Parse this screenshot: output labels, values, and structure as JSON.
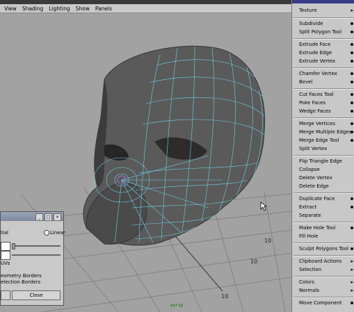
{
  "viewport_menu": [
    "View",
    "Shading",
    "Lighting",
    "Show",
    "Panels"
  ],
  "camera_label": "persp",
  "grid_labels": [
    "10",
    "10",
    "10"
  ],
  "marking_menu": {
    "items": [
      {
        "label": "Texture",
        "kind": "submenu"
      },
      {
        "label": "Subdivide",
        "kind": "option"
      },
      {
        "label": "Split Polygon Tool",
        "kind": "option"
      },
      {
        "label": "Extrude Face",
        "kind": "option"
      },
      {
        "label": "Extrude Edge",
        "kind": "option"
      },
      {
        "label": "Extrude Vertex",
        "kind": "option"
      },
      {
        "label": "Chamfer Vertex",
        "kind": "option"
      },
      {
        "label": "Bevel",
        "kind": "option"
      },
      {
        "label": "Cut Faces Tool",
        "kind": "option"
      },
      {
        "label": "Poke Faces",
        "kind": "option"
      },
      {
        "label": "Wedge Faces",
        "kind": "option"
      },
      {
        "label": "Merge Vertices",
        "kind": "option"
      },
      {
        "label": "Merge Multiple Edges",
        "kind": "option"
      },
      {
        "label": "Merge Edge Tool",
        "kind": "option"
      },
      {
        "label": "Split Vertex",
        "kind": "plain"
      },
      {
        "label": "Flip Triangle Edge",
        "kind": "plain"
      },
      {
        "label": "Collapse",
        "kind": "plain"
      },
      {
        "label": "Delete Vertex",
        "kind": "plain"
      },
      {
        "label": "Delete Edge",
        "kind": "plain"
      },
      {
        "label": "Duplicate Face",
        "kind": "option"
      },
      {
        "label": "Extract",
        "kind": "option"
      },
      {
        "label": "Separate",
        "kind": "plain"
      },
      {
        "label": "Make Hole Tool",
        "kind": "option"
      },
      {
        "label": "Fill Hole",
        "kind": "plain"
      },
      {
        "label": "Sculpt Polygons Tool",
        "kind": "option"
      },
      {
        "label": "Clipboard Actions",
        "kind": "submenu"
      },
      {
        "label": "Selection",
        "kind": "submenu"
      },
      {
        "label": "Colors",
        "kind": "submenu"
      },
      {
        "label": "Normals",
        "kind": "submenu"
      },
      {
        "label": "Move Component",
        "kind": "option"
      }
    ]
  },
  "dialog": {
    "radio_left": "tial",
    "radio_right": "Linear",
    "uvs_label": "UVs",
    "line1": "eometry Borders",
    "line2": "election Borders",
    "close_label": "Close"
  },
  "colors": {
    "wire": "#6fd3e8",
    "menu_bg": "#c8c8c8"
  }
}
